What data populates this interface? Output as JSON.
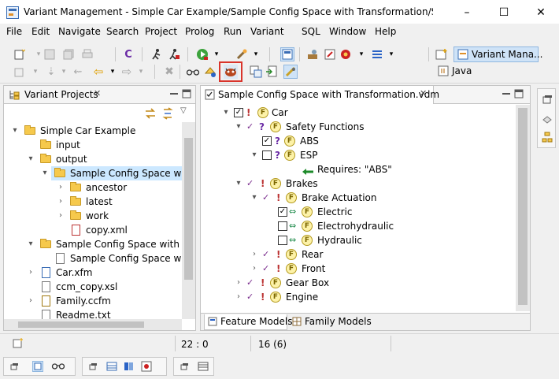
{
  "window": {
    "title": "Variant Management - Simple Car Example/Sample Config Space with Transformation/Sample Confi...",
    "minimize": "–",
    "maximize": "☐",
    "close": "✕"
  },
  "menu": [
    "File",
    "Edit",
    "Navigate",
    "Search",
    "Project",
    "Prolog",
    "Run",
    "Variant",
    "SQL",
    "Window",
    "Help"
  ],
  "perspectives": {
    "active": "Variant Mana...",
    "other": "Java"
  },
  "left_panel": {
    "title": "Variant Projects",
    "close": "✕",
    "tree": [
      {
        "label": "Simple Car Example",
        "icon": "project-folder"
      },
      {
        "label": "input",
        "icon": "folder"
      },
      {
        "label": "output",
        "icon": "folder"
      },
      {
        "label": "Sample Config Space with",
        "icon": "folder-open"
      },
      {
        "label": "ancestor",
        "icon": "folder"
      },
      {
        "label": "latest",
        "icon": "folder"
      },
      {
        "label": "work",
        "icon": "folder"
      },
      {
        "label": "copy.xml",
        "icon": "xml-file"
      },
      {
        "label": "Sample Config Space with Tra",
        "icon": "config-folder"
      },
      {
        "label": "Sample Config Space with",
        "icon": "vdm-file"
      },
      {
        "label": "Car.xfm",
        "icon": "xfm-file"
      },
      {
        "label": "ccm_copy.xsl",
        "icon": "xsl-file"
      },
      {
        "label": "Family.ccfm",
        "icon": "ccfm-file"
      },
      {
        "label": "Readme.txt",
        "icon": "text-file"
      }
    ]
  },
  "editor": {
    "tab_title": "Sample Config Space with Transformation.vdm",
    "close": "✕",
    "tree": [
      {
        "label": "Car",
        "check": "checked",
        "mark": "!"
      },
      {
        "label": "Safety Functions",
        "mark": "?"
      },
      {
        "label": "ABS",
        "check": "checked",
        "mark": "?"
      },
      {
        "label": "ESP",
        "check": "empty",
        "mark": "?"
      },
      {
        "label": "Requires: \"ABS\"",
        "icon": "requires-arrow"
      },
      {
        "label": "Brakes",
        "mark": "!"
      },
      {
        "label": "Brake Actuation",
        "mark": "!"
      },
      {
        "label": "Electric",
        "check": "checked",
        "icon": "alternative"
      },
      {
        "label": "Electrohydraulic",
        "check": "empty",
        "icon": "alternative"
      },
      {
        "label": "Hydraulic",
        "check": "empty",
        "icon": "alternative"
      },
      {
        "label": "Rear",
        "mark": "!"
      },
      {
        "label": "Front",
        "mark": "!"
      },
      {
        "label": "Gear Box",
        "mark": "!"
      },
      {
        "label": "Engine",
        "mark": "!"
      }
    ],
    "bottom_tabs": [
      "Feature Models",
      "Family Models"
    ]
  },
  "status": {
    "position": "22 : 0",
    "count": "16 (6)"
  },
  "colors": {
    "highlight_box": "#d9342b",
    "selection": "#cce8ff",
    "tick": "#7b2e8e",
    "alternative": "#1d8a4a"
  }
}
